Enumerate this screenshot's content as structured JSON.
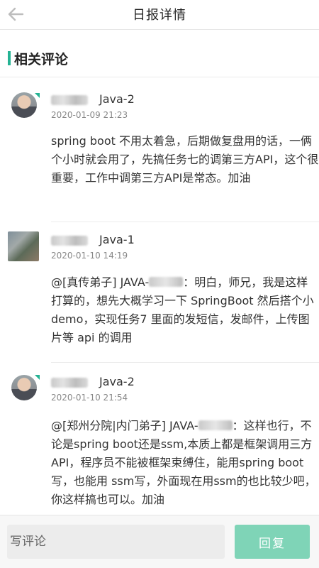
{
  "header": {
    "title": "日报详情"
  },
  "section": {
    "title": "相关评论"
  },
  "comments": [
    {
      "tag": "Java-2",
      "date": "2020-01-09 21:23",
      "content": "spring boot 不用太着急，后期做复盘用的话，一俩个小时就会用了，先搞任务七的调第三方API，这个很重要，工作中调第三方API是常态。加油"
    },
    {
      "tag": "Java-1",
      "date": "2020-01-10 14:19",
      "content_prefix": "@[真传弟子] JAVA-",
      "content_rest": "：明白，师兄，我是这样打算的，想先大概学习一下 SpringBoot 然后搭个小 demo，实现任务7 里面的发短信，发邮件，上传图片等 api 的调用"
    },
    {
      "tag": "Java-2",
      "date": "2020-01-10 21:54",
      "content_prefix": "@[郑州分院|内门弟子] JAVA-",
      "content_rest": "：这样也行，不论是spring boot还是ssm,本质上都是框架调用三方API，程序员不能被框架束缚住，能用spring boot写，也能用 ssm写，外面现在用ssm的也比较少吧，你这样搞也可以。加油"
    }
  ],
  "input": {
    "placeholder": "写评论"
  },
  "reply_button": {
    "label": "回复"
  },
  "colors": {
    "accent": "#25b394",
    "button": "#7fd4b7"
  }
}
